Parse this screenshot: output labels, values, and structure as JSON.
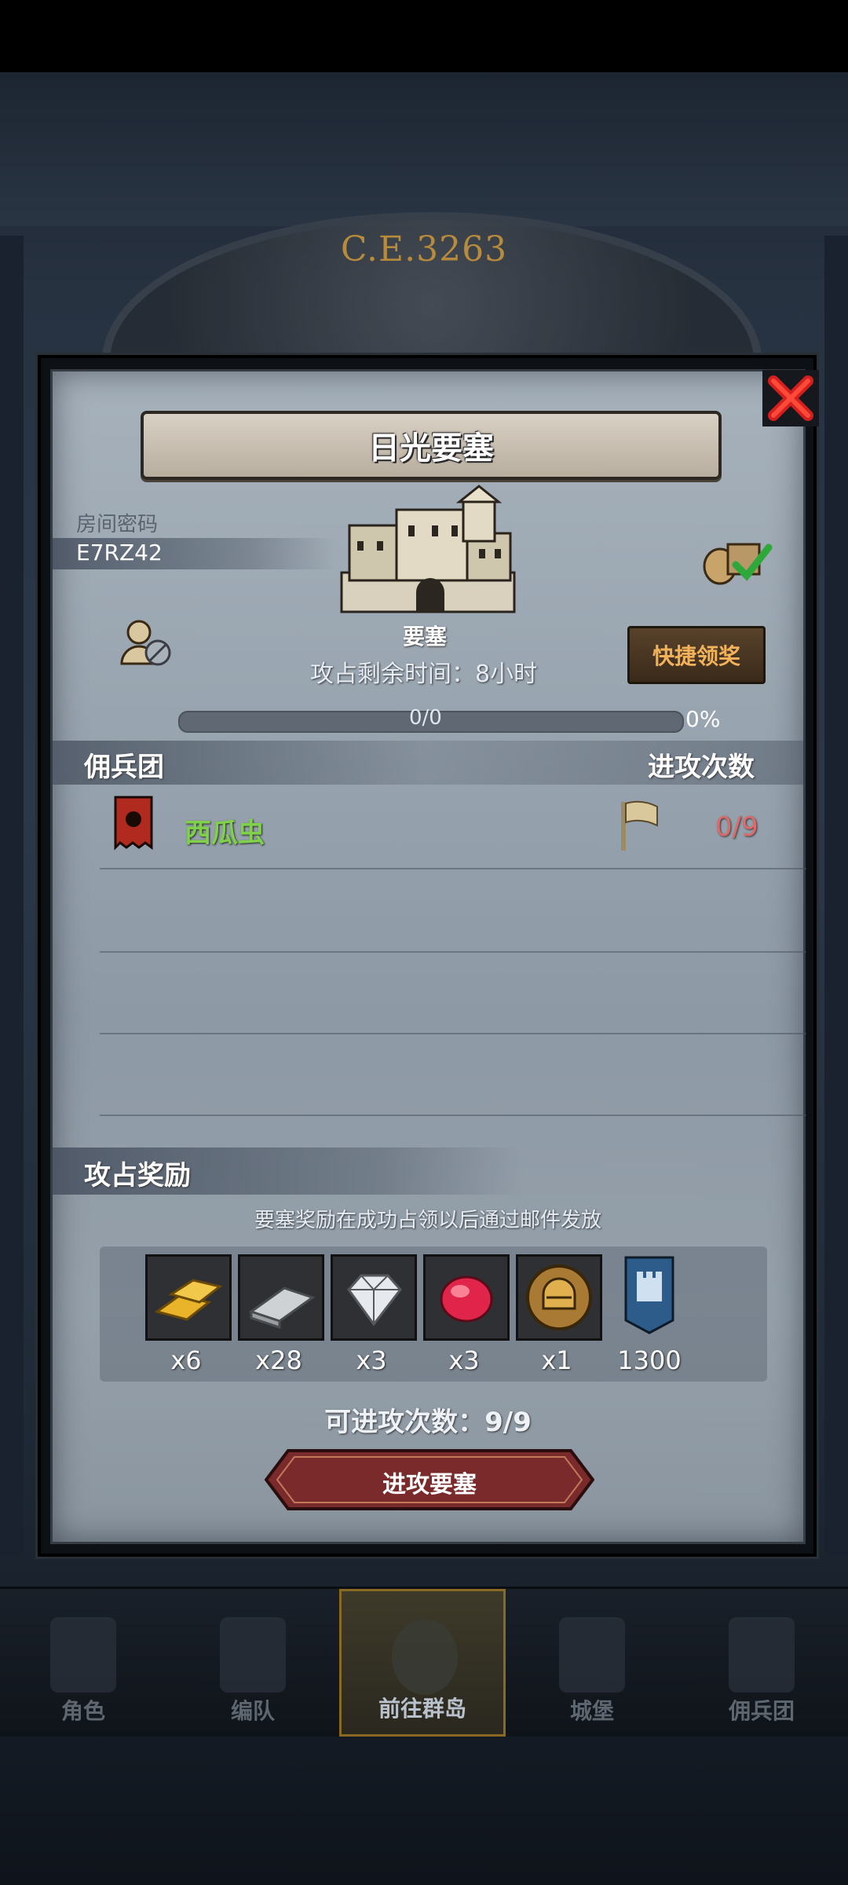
{
  "background": {
    "era_label": "C.E.3263"
  },
  "dialog": {
    "title": "日光要塞",
    "room_code_label": "房间密码",
    "room_code": "E7RZ42",
    "building_name": "要塞",
    "quick_claim_label": "快捷领奖",
    "time_label": "攻占剩余时间：",
    "time_value": "8小时",
    "progress_text": "0/0",
    "progress_percent_text": "0%",
    "progress_fraction": 0
  },
  "mercenary": {
    "header_left": "佣兵团",
    "header_right": "进攻次数",
    "rows": [
      {
        "name": "西瓜虫",
        "attacks": "0/9"
      }
    ]
  },
  "rewards": {
    "header": "攻占奖励",
    "note": "要塞奖励在成功占领以后通过邮件发放",
    "items": [
      {
        "icon": "gold-bars-icon",
        "qty": "x6"
      },
      {
        "icon": "iron-ingot-icon",
        "qty": "x28"
      },
      {
        "icon": "diamond-icon",
        "qty": "x3"
      },
      {
        "icon": "ruby-icon",
        "qty": "x3"
      },
      {
        "icon": "helmet-coin-icon",
        "qty": "x1"
      },
      {
        "icon": "castle-banner-icon",
        "qty": "1300"
      }
    ]
  },
  "attacks_available": "可进攻次数：9/9",
  "attack_button": "进攻要塞",
  "nav": [
    {
      "label": "角色",
      "icon": "knight-icon"
    },
    {
      "label": "编队",
      "icon": "horse-knight-icon"
    },
    {
      "label": "前往群岛",
      "icon": "globe-icon"
    },
    {
      "label": "城堡",
      "icon": "castle-icon"
    },
    {
      "label": "佣兵团",
      "icon": "mercenary-icon"
    }
  ],
  "colors": {
    "merc_name": "#7fd14a",
    "attacks_count": "#e06a6a",
    "quick_claim_text": "#f2b25a",
    "attack_button_fill": "#7a2a2a"
  }
}
